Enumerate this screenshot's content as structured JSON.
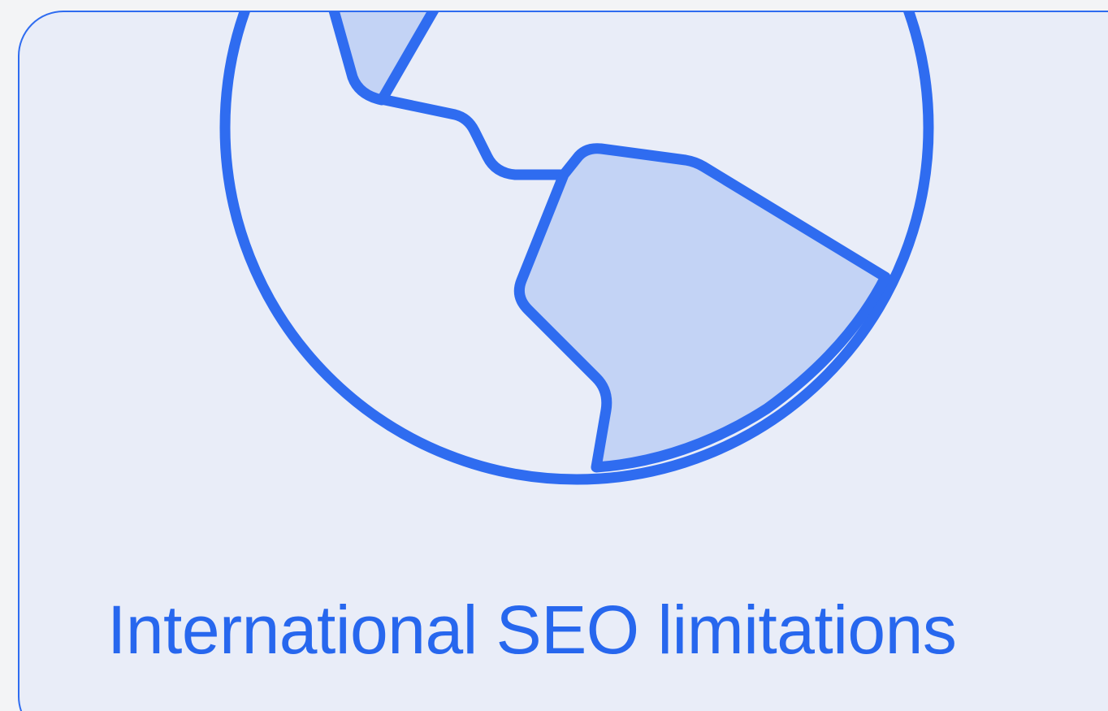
{
  "card": {
    "title": "International SEO limitations",
    "icon": "globe-americas-icon",
    "accent_color": "#2767ee",
    "fill_color": "#c3d3f5",
    "background_color": "#e9edf8"
  }
}
